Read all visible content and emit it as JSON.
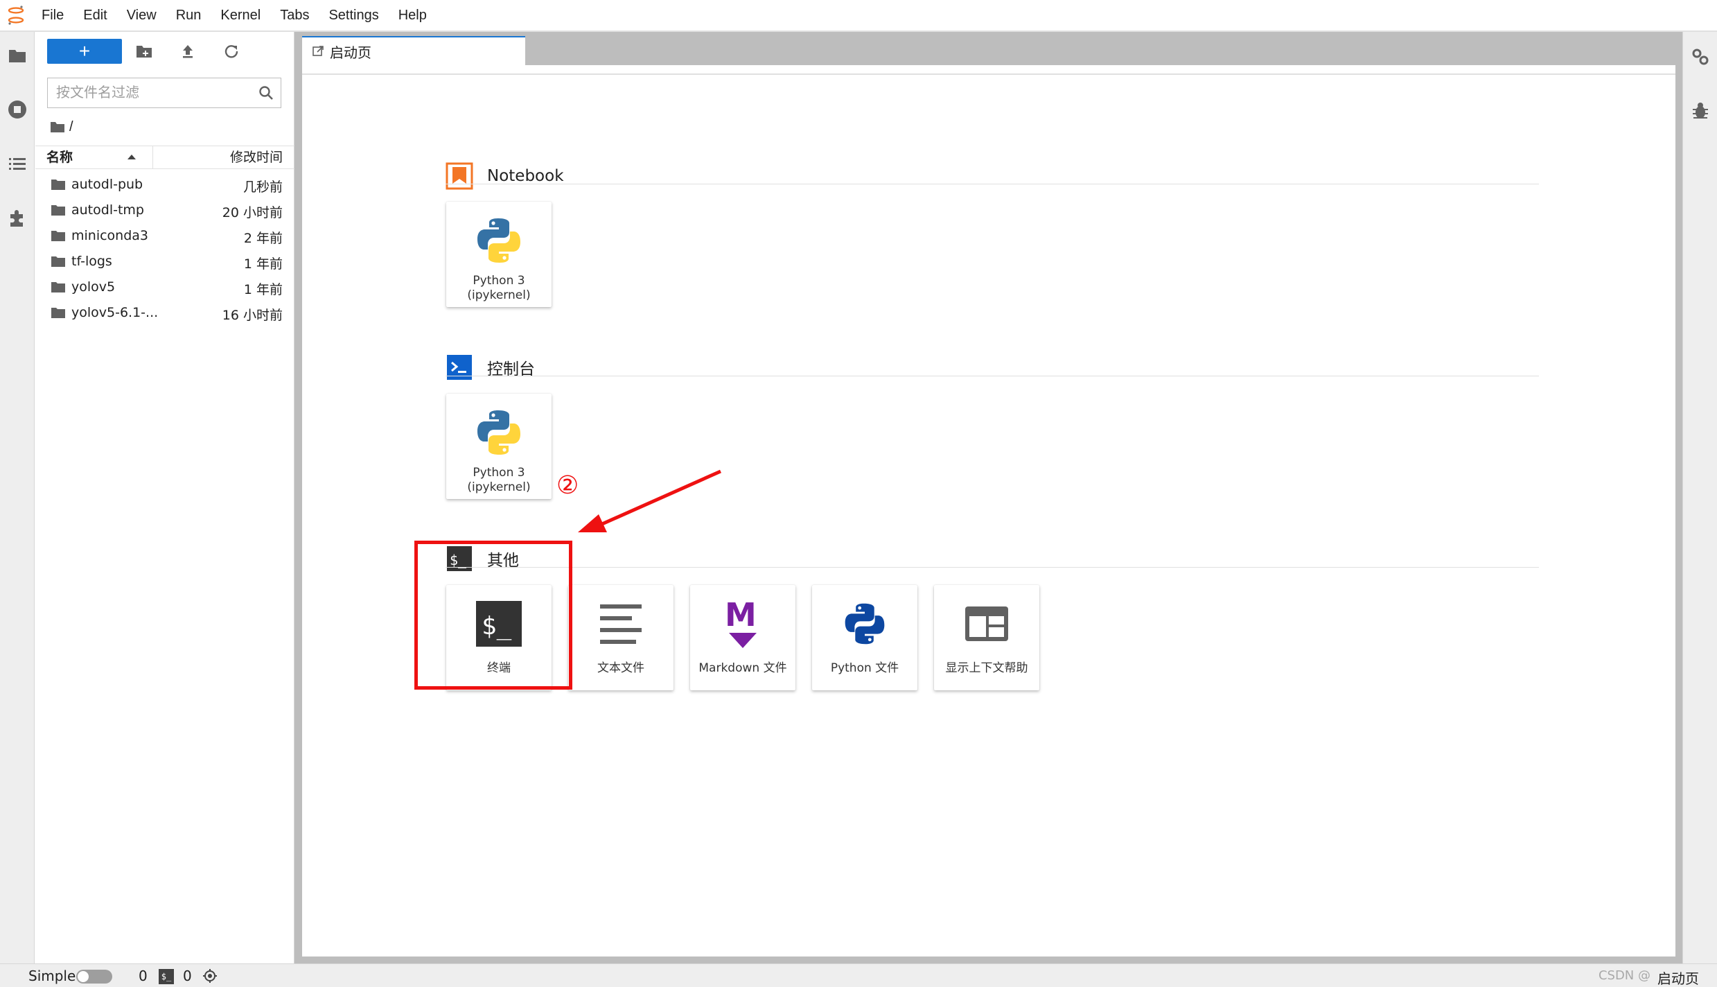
{
  "menubar": {
    "items": [
      "File",
      "Edit",
      "View",
      "Run",
      "Kernel",
      "Tabs",
      "Settings",
      "Help"
    ]
  },
  "filebrowser": {
    "new_button": "+",
    "filter_placeholder": "按文件名过滤",
    "breadcrumb": "/",
    "columns": {
      "name": "名称",
      "modified": "修改时间"
    },
    "files": [
      {
        "name": "autodl-pub",
        "modified": "几秒前"
      },
      {
        "name": "autodl-tmp",
        "modified": "20 小时前"
      },
      {
        "name": "miniconda3",
        "modified": "2 年前"
      },
      {
        "name": "tf-logs",
        "modified": "1 年前"
      },
      {
        "name": "yolov5",
        "modified": "1 年前"
      },
      {
        "name": "yolov5-6.1-...",
        "modified": "16 小时前"
      }
    ]
  },
  "tab": {
    "label": "启动页"
  },
  "launcher": {
    "sections": [
      {
        "title": "Notebook",
        "cards": [
          {
            "label": "Python 3\n(ipykernel)",
            "icon": "python-icon"
          }
        ]
      },
      {
        "title": "控制台",
        "cards": [
          {
            "label": "Python 3\n(ipykernel)",
            "icon": "python-icon"
          }
        ]
      },
      {
        "title": "其他",
        "cards": [
          {
            "label": "终端",
            "icon": "terminal-icon"
          },
          {
            "label": "文本文件",
            "icon": "text-file-icon"
          },
          {
            "label": "Markdown 文件",
            "icon": "markdown-icon"
          },
          {
            "label": "Python 文件",
            "icon": "python-file-icon"
          },
          {
            "label": "显示上下文帮助",
            "icon": "context-help-icon"
          }
        ]
      }
    ]
  },
  "annotation": {
    "marker": "②"
  },
  "statusbar": {
    "mode_label": "Simple",
    "kernel_count": "0",
    "terminal_count": "0",
    "terminal_glyph": "$_",
    "active_label": "启动页",
    "watermark": "CSDN @"
  },
  "colors": {
    "accent": "#1976d2",
    "annotation": "#ee1111",
    "notebook_icon": "#f37626",
    "markdown": "#7b1fa2"
  }
}
